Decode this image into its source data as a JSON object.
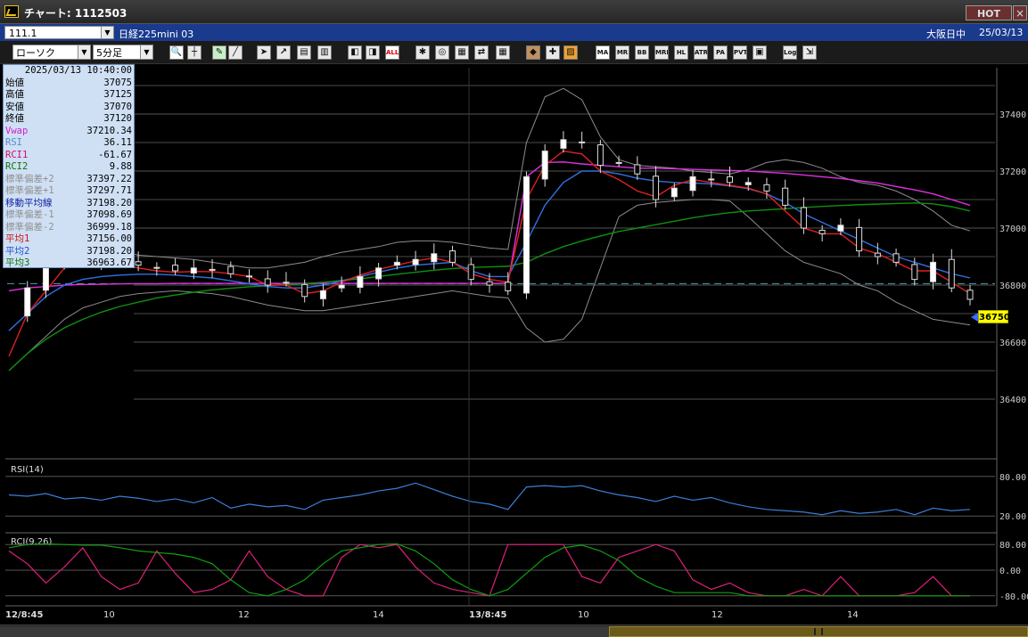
{
  "window": {
    "title": "チャート: 1112503",
    "hot_label": "HOT",
    "close_label": "×"
  },
  "header": {
    "symbol": "111.1",
    "instrument": "日経225mini 03",
    "market_status": "大阪日中",
    "date": "25/03/13"
  },
  "toolbar": {
    "chart_type": "ローソク",
    "interval": "5分足",
    "icons": [
      "zoom-icon",
      "crosshair-icon",
      "pen-icon",
      "line-tool-icon",
      "cursor-icon",
      "arrow-icon",
      "copy-icon",
      "delete-icon",
      "bar-left-icon",
      "bar-right-icon",
      "all-icon",
      "settings-icon",
      "search-icon",
      "layout-icon",
      "compare-icon",
      "grid-icon",
      "palette-icon",
      "wrench-icon",
      "color-icon",
      "ma-icon",
      "mr-icon",
      "bb-icon",
      "mre-icon",
      "hl-icon",
      "atr-icon",
      "pa-icon",
      "pvt-icon",
      "box-icon",
      "log-icon",
      "export-icon"
    ],
    "text_buttons": {
      "all": "ALL",
      "ma": "MA",
      "mr": "MR",
      "bb": "BB",
      "mre": "MRE",
      "hl": "HL",
      "atr": "ATR",
      "pa": "PA",
      "pvt": "PVT",
      "log": "Log"
    }
  },
  "info_panel": {
    "datetime": "2025/03/13 10:40:00",
    "rows": [
      {
        "label": "始値",
        "value": "37075",
        "color": "#000000"
      },
      {
        "label": "高値",
        "value": "37125",
        "color": "#000000"
      },
      {
        "label": "安値",
        "value": "37070",
        "color": "#000000"
      },
      {
        "label": "終値",
        "value": "37120",
        "color": "#000000"
      },
      {
        "label": "Vwap",
        "value": "37210.34",
        "color": "#d020d0"
      },
      {
        "label": "RSI",
        "value": "36.11",
        "color": "#5a8ad0"
      },
      {
        "label": "RCI1",
        "value": "-61.67",
        "color": "#d01070"
      },
      {
        "label": "RCI2",
        "value": "9.88",
        "color": "#107010"
      },
      {
        "label": "標準偏差+2",
        "value": "37397.22",
        "color": "#909090"
      },
      {
        "label": "標準偏差+1",
        "value": "37297.71",
        "color": "#909090"
      },
      {
        "label": "移動平均線",
        "value": "37198.20",
        "color": "#1020a0"
      },
      {
        "label": "標準偏差-1",
        "value": "37098.69",
        "color": "#909090"
      },
      {
        "label": "標準偏差-2",
        "value": "36999.18",
        "color": "#909090"
      },
      {
        "label": "平均1",
        "value": "37156.00",
        "color": "#d01010"
      },
      {
        "label": "平均2",
        "value": "37198.20",
        "color": "#2050d0"
      },
      {
        "label": "平均3",
        "value": "36963.67",
        "color": "#107010"
      }
    ]
  },
  "price_axis": [
    "37400",
    "37200",
    "37000",
    "36800",
    "36600",
    "36400"
  ],
  "current_price": "36750",
  "rsi_panel": {
    "title": "RSI(14)",
    "ticks": [
      "80.00",
      "20.00"
    ]
  },
  "rci_panel": {
    "title": "RCI(9,26)",
    "ticks": [
      "80.00",
      "0.00",
      "-80.00"
    ]
  },
  "time_axis": [
    "12/8:45",
    "10",
    "12",
    "14",
    "13/8:45",
    "10",
    "12",
    "14"
  ],
  "chart_data": {
    "type": "line",
    "title": "",
    "x_labels": [
      "12/8:45",
      "10",
      "12",
      "14",
      "13/8:45",
      "10",
      "12",
      "14"
    ],
    "price": {
      "ylim": [
        36200,
        37550
      ],
      "close": [
        36700,
        36790,
        36860,
        36940,
        36920,
        36880,
        36890,
        36870,
        36860,
        36850,
        36860,
        36855,
        36840,
        36830,
        36800,
        36810,
        36760,
        36780,
        36800,
        36830,
        36860,
        36880,
        36890,
        36910,
        36880,
        36820,
        36800,
        36780,
        37180,
        37270,
        37310,
        37300,
        37220,
        37230,
        37190,
        37100,
        37140,
        37180,
        37170,
        37160,
        37160,
        37130,
        37080,
        37000,
        36980,
        37010,
        36920,
        36900,
        36880,
        36820,
        36880,
        36790,
        36750
      ],
      "ma_short": [
        36550,
        36700,
        36780,
        36860,
        36890,
        36880,
        36875,
        36860,
        36850,
        36845,
        36848,
        36847,
        36840,
        36830,
        36800,
        36800,
        36770,
        36780,
        36810,
        36835,
        36855,
        36870,
        36885,
        36895,
        36880,
        36840,
        36820,
        36810,
        37100,
        37220,
        37270,
        37260,
        37200,
        37170,
        37130,
        37110,
        37150,
        37170,
        37160,
        37150,
        37140,
        37120,
        37060,
        37000,
        36980,
        36980,
        36930,
        36910,
        36880,
        36850,
        36850,
        36810,
        36770
      ],
      "ma_mid": [
        36640,
        36700,
        36760,
        36800,
        36820,
        36830,
        36835,
        36838,
        36838,
        36835,
        36830,
        36825,
        36815,
        36805,
        36795,
        36790,
        36790,
        36800,
        36815,
        36830,
        36845,
        36860,
        36870,
        36875,
        36880,
        36850,
        36830,
        36830,
        36950,
        37080,
        37160,
        37200,
        37200,
        37190,
        37175,
        37165,
        37160,
        37158,
        37155,
        37148,
        37138,
        37120,
        37090,
        37050,
        37020,
        36990,
        36960,
        36930,
        36900,
        36880,
        36860,
        36840,
        36825
      ],
      "ma_long": [
        36500,
        36560,
        36610,
        36650,
        36680,
        36705,
        36725,
        36740,
        36755,
        36765,
        36775,
        36783,
        36789,
        36794,
        36798,
        36802,
        36805,
        36810,
        36816,
        36822,
        36830,
        36838,
        36845,
        36852,
        36858,
        36862,
        36864,
        36866,
        36880,
        36910,
        36935,
        36955,
        36972,
        36988,
        37000,
        37012,
        37024,
        37036,
        37046,
        37054,
        37060,
        37064,
        37068,
        37072,
        37076,
        37079,
        37082,
        37084,
        37086,
        37088,
        37085,
        37075,
        37060
      ],
      "vwap": [
        36780,
        36790,
        36795,
        36800,
        36802,
        36803,
        36804,
        36805,
        36805,
        36806,
        36806,
        36806,
        36806,
        36806,
        36806,
        36806,
        36806,
        36806,
        36806,
        36806,
        36806,
        36806,
        36806,
        36806,
        36806,
        36806,
        36806,
        36806,
        37180,
        37230,
        37232,
        37225,
        37220,
        37215,
        37210,
        37210,
        37208,
        37206,
        37204,
        37202,
        37200,
        37196,
        37192,
        37186,
        37180,
        37174,
        37166,
        37158,
        37146,
        37134,
        37120,
        37100,
        37080
      ],
      "bb_upper2": [
        36920,
        36960,
        36980,
        36985,
        36970,
        36940,
        36920,
        36905,
        36900,
        36895,
        36890,
        36880,
        36870,
        36860,
        36860,
        36870,
        36880,
        36900,
        36915,
        36925,
        36935,
        36950,
        36955,
        36955,
        36950,
        36940,
        36930,
        36925,
        37300,
        37460,
        37490,
        37450,
        37320,
        37240,
        37220,
        37215,
        37210,
        37200,
        37195,
        37190,
        37205,
        37230,
        37240,
        37230,
        37210,
        37180,
        37160,
        37150,
        37130,
        37100,
        37060,
        37010,
        36990
      ],
      "bb_lower2": [
        36500,
        36560,
        36620,
        36680,
        36720,
        36740,
        36760,
        36770,
        36775,
        36780,
        36775,
        36770,
        36760,
        36745,
        36730,
        36720,
        36710,
        36710,
        36720,
        36730,
        36740,
        36750,
        36760,
        36770,
        36780,
        36770,
        36760,
        36755,
        36650,
        36600,
        36610,
        36680,
        36860,
        37040,
        37080,
        37090,
        37095,
        37100,
        37100,
        37095,
        37040,
        36980,
        36920,
        36880,
        36860,
        36840,
        36800,
        36780,
        36740,
        36710,
        36680,
        36670,
        36660
      ]
    },
    "rsi": {
      "ylim": [
        0,
        100
      ],
      "values": [
        52,
        50,
        54,
        46,
        48,
        44,
        50,
        47,
        42,
        46,
        40,
        48,
        32,
        38,
        34,
        36,
        30,
        44,
        48,
        52,
        58,
        62,
        70,
        60,
        50,
        42,
        38,
        30,
        64,
        66,
        64,
        66,
        58,
        52,
        48,
        42,
        50,
        44,
        48,
        40,
        34,
        30,
        28,
        26,
        22,
        28,
        24,
        26,
        30,
        22,
        32,
        28,
        30
      ]
    },
    "rci1": {
      "ylim": [
        -100,
        100
      ],
      "values": [
        60,
        20,
        -40,
        10,
        70,
        -20,
        -60,
        -40,
        60,
        -10,
        -70,
        -60,
        -30,
        60,
        -20,
        -60,
        -80,
        -80,
        40,
        80,
        70,
        80,
        10,
        -40,
        -60,
        -70,
        -80,
        80,
        80,
        80,
        80,
        -20,
        -40,
        40,
        60,
        80,
        60,
        -30,
        -60,
        -40,
        -70,
        -80,
        -80,
        -60,
        -80,
        -20,
        -80,
        -80,
        -80,
        -70,
        -20,
        -80,
        -80
      ]
    },
    "rci2": {
      "ylim": [
        -100,
        100
      ],
      "values": [
        70,
        80,
        82,
        80,
        78,
        78,
        70,
        60,
        55,
        50,
        40,
        20,
        -30,
        -70,
        -80,
        -60,
        -30,
        20,
        60,
        70,
        80,
        82,
        60,
        20,
        -30,
        -60,
        -80,
        -60,
        -10,
        40,
        70,
        78,
        60,
        30,
        -20,
        -50,
        -70,
        -70,
        -70,
        -70,
        -80,
        -80,
        -80,
        -80,
        -80,
        -80,
        -80,
        -80,
        -80,
        -80,
        -80,
        -80,
        -80
      ]
    }
  }
}
